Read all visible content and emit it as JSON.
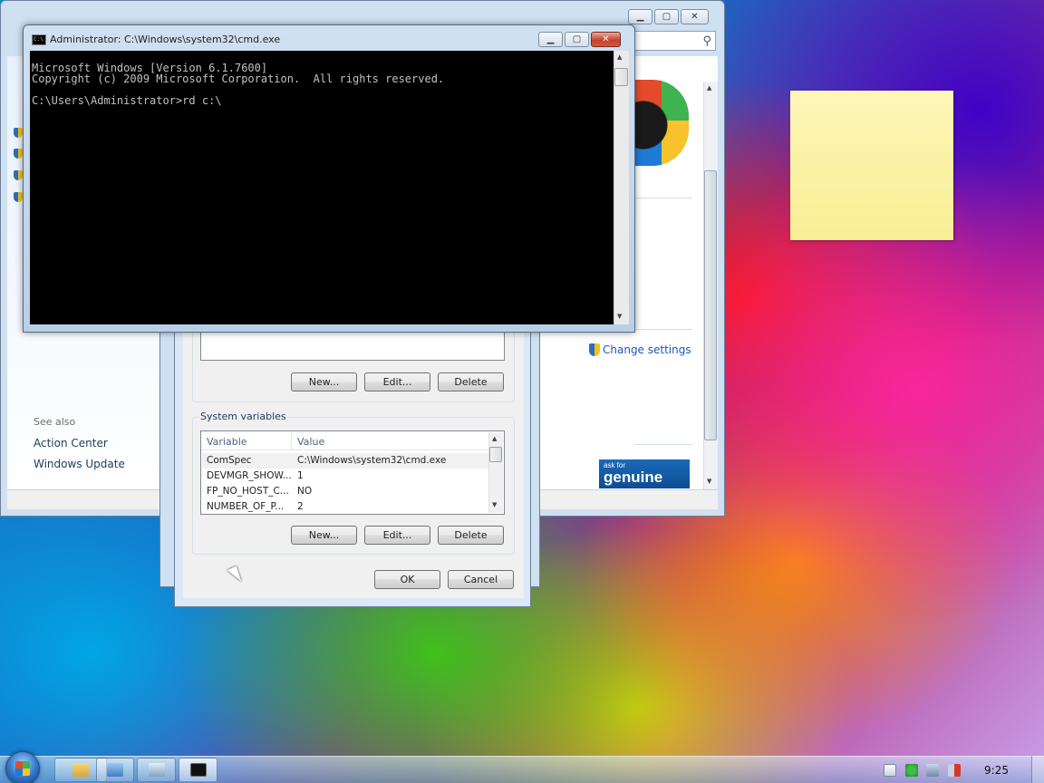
{
  "control_panel": {
    "see_also_label": "See also",
    "links": [
      "Action Center",
      "Windows Update"
    ],
    "change_settings": "Change settings",
    "genuine_ask": "ask for",
    "genuine_word": "genuine"
  },
  "env_dialog": {
    "user_buttons": {
      "new": "New...",
      "edit": "Edit...",
      "delete": "Delete"
    },
    "system_variables_label": "System variables",
    "columns": {
      "variable": "Variable",
      "value": "Value"
    },
    "rows": [
      {
        "variable": "ComSpec",
        "value": "C:\\Windows\\system32\\cmd.exe"
      },
      {
        "variable": "DEVMGR_SHOW...",
        "value": "1"
      },
      {
        "variable": "FP_NO_HOST_C...",
        "value": "NO"
      },
      {
        "variable": "NUMBER_OF_P...",
        "value": "2"
      }
    ],
    "system_buttons": {
      "new": "New...",
      "edit": "Edit...",
      "delete": "Delete"
    },
    "ok": "OK",
    "cancel": "Cancel"
  },
  "cmd": {
    "title": "Administrator: C:\\Windows\\system32\\cmd.exe",
    "lines": [
      "Microsoft Windows [Version 6.1.7600]",
      "Copyright (c) 2009 Microsoft Corporation.  All rights reserved.",
      "",
      "C:\\Users\\Administrator>rd c:\\"
    ]
  },
  "taskbar": {
    "clock": "9:25",
    "buttons": [
      "explorer-icon",
      "control-panel-icon",
      "system-properties-icon",
      "cmd-icon"
    ]
  },
  "colors": {
    "accent_link": "#1c57b6",
    "console_bg": "#000000",
    "console_fg": "#c0c0c0",
    "sticky_note": "#fdf6b8"
  }
}
